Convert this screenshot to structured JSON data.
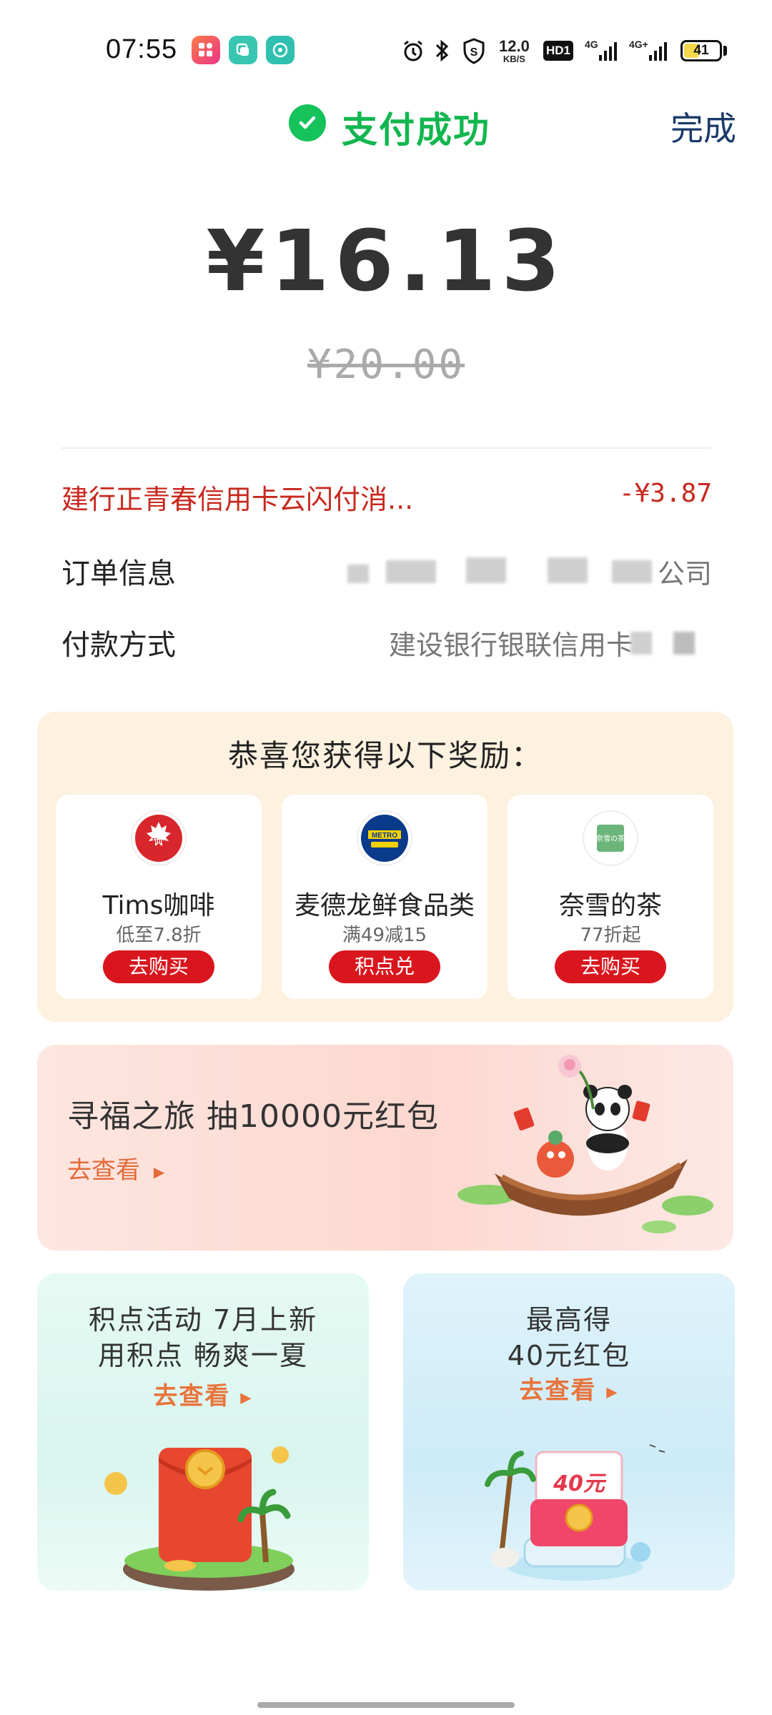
{
  "status_bar": {
    "time": "07:55",
    "apps": [
      "app-icon-1",
      "app-icon-2",
      "app-icon-3"
    ],
    "speed_value": "12.0",
    "speed_unit": "KB/S",
    "hd_label": "HD1",
    "net1": "4G",
    "net2": "4G+",
    "battery": "41",
    "battery_level": 0.41
  },
  "header": {
    "title": "支付成功",
    "done": "完成"
  },
  "payment": {
    "amount": "¥16.13",
    "original_amount": "¥20.00"
  },
  "details": {
    "discount_label": "建行正青春信用卡云闪付消...",
    "discount_value": "-¥3.87",
    "order_label": "订单信息",
    "order_value_suffix": "公司",
    "method_label": "付款方式",
    "method_value": "建设银行银联信用卡"
  },
  "rewards": {
    "title": "恭喜您获得以下奖励：",
    "items": [
      {
        "name": "Tims咖啡",
        "desc": "低至7.8折",
        "button": "去购买",
        "logo_text": "Tims",
        "logo_color": "#d7262c"
      },
      {
        "name": "麦德龙鲜食品类",
        "desc": "满49减15",
        "button": "积点兑",
        "logo_text": "METRO",
        "logo_color": "#0a3a8a"
      },
      {
        "name": "奈雪的茶",
        "desc": "77折起",
        "button": "去购买",
        "logo_text": "奈雪の茶",
        "logo_color": "#5aa96a"
      }
    ]
  },
  "banner": {
    "title": "寻福之旅  抽10000元红包",
    "link": "去查看"
  },
  "promos": [
    {
      "line1": "积点活动 7月上新",
      "line2": "用积点 畅爽一夏",
      "link": "去查看",
      "badge": ""
    },
    {
      "line1": "最高得",
      "line2": "40元红包",
      "link": "去查看",
      "badge": "40元"
    }
  ],
  "colors": {
    "success_green": "#12b64f",
    "discount_red": "#c8281e",
    "button_red": "#d9161e",
    "link_orange": "#e8743c",
    "done_blue": "#1a3a6b"
  }
}
